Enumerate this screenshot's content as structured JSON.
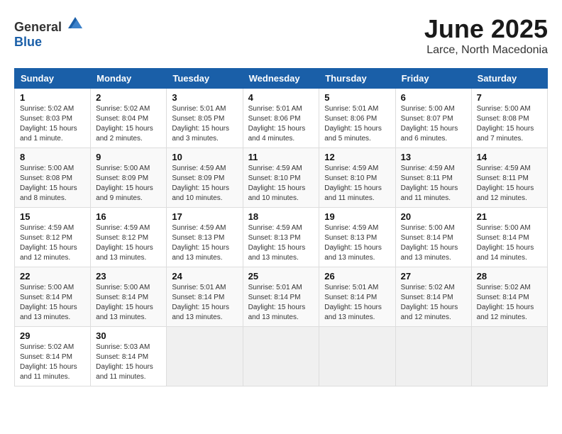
{
  "header": {
    "logo_general": "General",
    "logo_blue": "Blue",
    "month": "June 2025",
    "location": "Larce, North Macedonia"
  },
  "weekdays": [
    "Sunday",
    "Monday",
    "Tuesday",
    "Wednesday",
    "Thursday",
    "Friday",
    "Saturday"
  ],
  "weeks": [
    [
      {
        "day": 1,
        "sunrise": "5:02 AM",
        "sunset": "8:03 PM",
        "daylight": "15 hours and 1 minute."
      },
      {
        "day": 2,
        "sunrise": "5:02 AM",
        "sunset": "8:04 PM",
        "daylight": "15 hours and 2 minutes."
      },
      {
        "day": 3,
        "sunrise": "5:01 AM",
        "sunset": "8:05 PM",
        "daylight": "15 hours and 3 minutes."
      },
      {
        "day": 4,
        "sunrise": "5:01 AM",
        "sunset": "8:06 PM",
        "daylight": "15 hours and 4 minutes."
      },
      {
        "day": 5,
        "sunrise": "5:01 AM",
        "sunset": "8:06 PM",
        "daylight": "15 hours and 5 minutes."
      },
      {
        "day": 6,
        "sunrise": "5:00 AM",
        "sunset": "8:07 PM",
        "daylight": "15 hours and 6 minutes."
      },
      {
        "day": 7,
        "sunrise": "5:00 AM",
        "sunset": "8:08 PM",
        "daylight": "15 hours and 7 minutes."
      }
    ],
    [
      {
        "day": 8,
        "sunrise": "5:00 AM",
        "sunset": "8:08 PM",
        "daylight": "15 hours and 8 minutes."
      },
      {
        "day": 9,
        "sunrise": "5:00 AM",
        "sunset": "8:09 PM",
        "daylight": "15 hours and 9 minutes."
      },
      {
        "day": 10,
        "sunrise": "4:59 AM",
        "sunset": "8:09 PM",
        "daylight": "15 hours and 10 minutes."
      },
      {
        "day": 11,
        "sunrise": "4:59 AM",
        "sunset": "8:10 PM",
        "daylight": "15 hours and 10 minutes."
      },
      {
        "day": 12,
        "sunrise": "4:59 AM",
        "sunset": "8:10 PM",
        "daylight": "15 hours and 11 minutes."
      },
      {
        "day": 13,
        "sunrise": "4:59 AM",
        "sunset": "8:11 PM",
        "daylight": "15 hours and 11 minutes."
      },
      {
        "day": 14,
        "sunrise": "4:59 AM",
        "sunset": "8:11 PM",
        "daylight": "15 hours and 12 minutes."
      }
    ],
    [
      {
        "day": 15,
        "sunrise": "4:59 AM",
        "sunset": "8:12 PM",
        "daylight": "15 hours and 12 minutes."
      },
      {
        "day": 16,
        "sunrise": "4:59 AM",
        "sunset": "8:12 PM",
        "daylight": "15 hours and 13 minutes."
      },
      {
        "day": 17,
        "sunrise": "4:59 AM",
        "sunset": "8:13 PM",
        "daylight": "15 hours and 13 minutes."
      },
      {
        "day": 18,
        "sunrise": "4:59 AM",
        "sunset": "8:13 PM",
        "daylight": "15 hours and 13 minutes."
      },
      {
        "day": 19,
        "sunrise": "4:59 AM",
        "sunset": "8:13 PM",
        "daylight": "15 hours and 13 minutes."
      },
      {
        "day": 20,
        "sunrise": "5:00 AM",
        "sunset": "8:14 PM",
        "daylight": "15 hours and 13 minutes."
      },
      {
        "day": 21,
        "sunrise": "5:00 AM",
        "sunset": "8:14 PM",
        "daylight": "15 hours and 14 minutes."
      }
    ],
    [
      {
        "day": 22,
        "sunrise": "5:00 AM",
        "sunset": "8:14 PM",
        "daylight": "15 hours and 13 minutes."
      },
      {
        "day": 23,
        "sunrise": "5:00 AM",
        "sunset": "8:14 PM",
        "daylight": "15 hours and 13 minutes."
      },
      {
        "day": 24,
        "sunrise": "5:01 AM",
        "sunset": "8:14 PM",
        "daylight": "15 hours and 13 minutes."
      },
      {
        "day": 25,
        "sunrise": "5:01 AM",
        "sunset": "8:14 PM",
        "daylight": "15 hours and 13 minutes."
      },
      {
        "day": 26,
        "sunrise": "5:01 AM",
        "sunset": "8:14 PM",
        "daylight": "15 hours and 13 minutes."
      },
      {
        "day": 27,
        "sunrise": "5:02 AM",
        "sunset": "8:14 PM",
        "daylight": "15 hours and 12 minutes."
      },
      {
        "day": 28,
        "sunrise": "5:02 AM",
        "sunset": "8:14 PM",
        "daylight": "15 hours and 12 minutes."
      }
    ],
    [
      {
        "day": 29,
        "sunrise": "5:02 AM",
        "sunset": "8:14 PM",
        "daylight": "15 hours and 11 minutes."
      },
      {
        "day": 30,
        "sunrise": "5:03 AM",
        "sunset": "8:14 PM",
        "daylight": "15 hours and 11 minutes."
      },
      null,
      null,
      null,
      null,
      null
    ]
  ],
  "labels": {
    "sunrise": "Sunrise:",
    "sunset": "Sunset:",
    "daylight": "Daylight:"
  }
}
